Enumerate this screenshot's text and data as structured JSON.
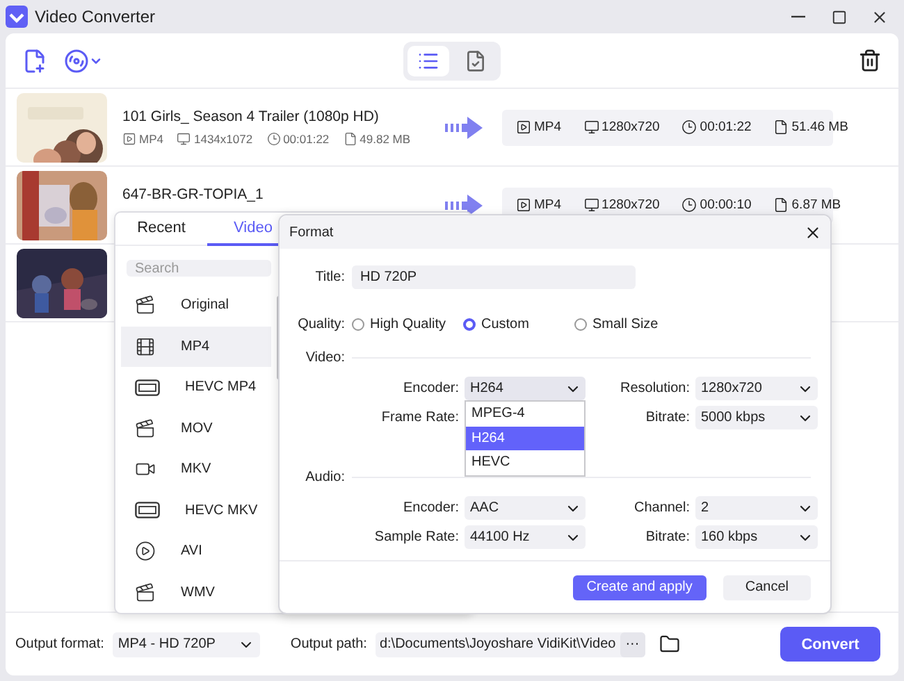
{
  "window": {
    "title": "Video Converter"
  },
  "toolbar": {
    "view_tabs": [
      {
        "kind": "list",
        "selected": true
      },
      {
        "kind": "tasks",
        "selected": false
      }
    ]
  },
  "files": [
    {
      "thumbnail": {
        "kind": "picture"
      },
      "name": "101 Girls_ Season 4 Trailer (1080p HD)",
      "source": {
        "format": "MP4",
        "resolution": "1434x1072",
        "duration": "00:01:22",
        "size": "49.82 MB"
      },
      "output": {
        "format": "MP4",
        "resolution": "1280x720",
        "duration": "00:01:22",
        "size": "51.46 MB"
      }
    },
    {
      "thumbnail": {
        "kind": "picture"
      },
      "name": "647-BR-GR-TOPIA_1",
      "output": {
        "format": "MP4",
        "resolution": "1280x720",
        "duration": "00:00:10",
        "size": "6.87 MB"
      }
    },
    {
      "thumbnail": {
        "kind": "picture"
      }
    }
  ],
  "format_panel": {
    "tabs": [
      {
        "label": "Recent",
        "selected": false
      },
      {
        "label": "Video",
        "selected": true
      }
    ],
    "search": {
      "placeholder": "Search"
    },
    "items": [
      {
        "label": "Original",
        "kind": "clapper",
        "selected": false
      },
      {
        "label": "MP4",
        "kind": "film",
        "selected": true
      },
      {
        "label": "HEVC MP4",
        "kind": "hevc",
        "selected": false
      },
      {
        "label": "MOV",
        "kind": "clapper",
        "selected": false
      },
      {
        "label": "MKV",
        "kind": "camera",
        "selected": false
      },
      {
        "label": "HEVC MKV",
        "kind": "hevc",
        "selected": false
      },
      {
        "label": "AVI",
        "kind": "play",
        "selected": false
      },
      {
        "label": "WMV",
        "kind": "clapper",
        "selected": false
      }
    ]
  },
  "dialog": {
    "title": "Format",
    "title_field": {
      "label": "Title:",
      "value": "HD 720P"
    },
    "quality": {
      "label": "Quality:",
      "options": [
        {
          "label": "High Quality",
          "selected": false
        },
        {
          "label": "Custom",
          "selected": true
        },
        {
          "label": "Small Size",
          "selected": false
        }
      ]
    },
    "sections": [
      {
        "label": "Video:",
        "fields": [
          {
            "label": "Encoder:",
            "value": "H264",
            "open": true,
            "options": [
              {
                "label": "MPEG-4",
                "selected": false
              },
              {
                "label": "H264",
                "selected": true
              },
              {
                "label": "HEVC",
                "selected": false
              }
            ]
          },
          {
            "label": "Resolution:",
            "value": "1280x720"
          },
          {
            "label": "Frame Rate:"
          },
          {
            "label": "Bitrate:",
            "value": "5000 kbps"
          }
        ]
      },
      {
        "label": "Audio:",
        "fields": [
          {
            "label": "Encoder:",
            "value": "AAC"
          },
          {
            "label": "Channel:",
            "value": "2"
          },
          {
            "label": "Sample Rate:",
            "value": "44100 Hz"
          },
          {
            "label": "Bitrate:",
            "value": "160 kbps"
          }
        ]
      }
    ],
    "buttons": [
      {
        "label": "Create and apply",
        "kind": "primary"
      },
      {
        "label": "Cancel",
        "kind": "secondary"
      }
    ]
  },
  "bottom_bar": {
    "output_format": {
      "label": "Output format:",
      "value": "MP4 - HD 720P"
    },
    "output_path": {
      "label": "Output path:",
      "value": "d:\\Documents\\Joyoshare VidiKit\\Video",
      "more": "···"
    },
    "convert": "Convert"
  }
}
